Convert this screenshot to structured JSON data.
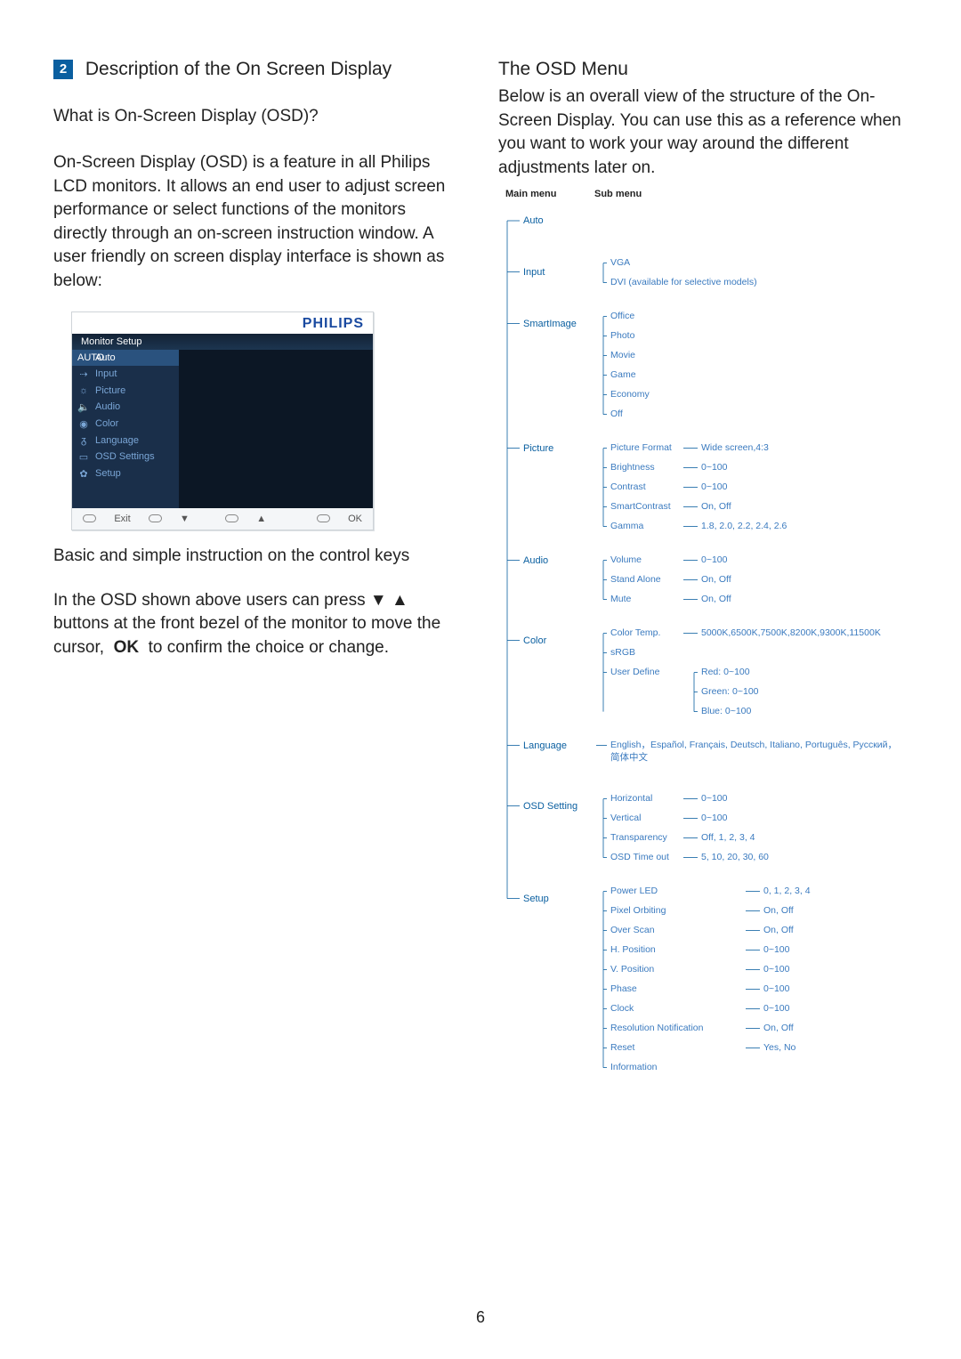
{
  "section_number": "2",
  "title": "Description of the On Screen Display",
  "q": "What is On-Screen Display (OSD)?",
  "body1": "On-Screen Display (OSD) is a feature in all Philips LCD monitors. It allows an end user to adjust screen performance or select functions of the monitors directly through an on-screen instruction window. A user friendly on screen display interface is shown as below:",
  "osd": {
    "brand": "PHILIPS",
    "header": "Monitor Setup",
    "items": [
      {
        "icon": "AUTO",
        "label": "Auto",
        "sel": true
      },
      {
        "icon": "⇢",
        "label": "Input"
      },
      {
        "icon": "☼",
        "label": "Picture"
      },
      {
        "icon": "🔈",
        "label": "Audio"
      },
      {
        "icon": "◉",
        "label": "Color"
      },
      {
        "icon": "ᵹ",
        "label": "Language"
      },
      {
        "icon": "▭",
        "label": "OSD Settings"
      },
      {
        "icon": "✿",
        "label": "Setup"
      }
    ],
    "foot": {
      "exit": "Exit",
      "ok": "OK"
    }
  },
  "basic_heading": "Basic and simple instruction on the control keys",
  "basic_body": "In the OSD shown above users can press ▼ ▲ buttons at the front bezel of the monitor to move the cursor,  OK  to confirm the choice or change.",
  "right_heading": "The OSD Menu",
  "right_body": "Below is an overall view of the structure of the On-Screen Display. You can use this as a reference when you want to work your way around the different adjustments later on.",
  "tree_header": {
    "main": "Main menu",
    "sub": "Sub menu"
  },
  "menu": {
    "auto": "Auto",
    "input": {
      "label": "Input",
      "items": [
        "VGA",
        "DVI (available for selective models)"
      ]
    },
    "smartimage": {
      "label": "SmartImage",
      "items": [
        "Office",
        "Photo",
        "Movie",
        "Game",
        "Economy",
        "Off"
      ]
    },
    "picture": {
      "label": "Picture",
      "items": [
        {
          "k": "Picture Format",
          "v": "Wide screen,4:3"
        },
        {
          "k": "Brightness",
          "v": "0~100"
        },
        {
          "k": "Contrast",
          "v": "0~100"
        },
        {
          "k": "SmartContrast",
          "v": "On, Off"
        },
        {
          "k": "Gamma",
          "v": "1.8, 2.0, 2.2, 2.4, 2.6"
        }
      ]
    },
    "audio": {
      "label": "Audio",
      "items": [
        {
          "k": "Volume",
          "v": "0~100"
        },
        {
          "k": "Stand Alone",
          "v": "On, Off"
        },
        {
          "k": "Mute",
          "v": "On, Off"
        }
      ]
    },
    "color": {
      "label": "Color",
      "items": [
        {
          "k": "Color Temp.",
          "v": "5000K,6500K,7500K,8200K,9300K,11500K"
        },
        {
          "k": "sRGB",
          "v": ""
        },
        {
          "k": "User Define",
          "sub": [
            "Red: 0~100",
            "Green: 0~100",
            "Blue: 0~100"
          ]
        }
      ]
    },
    "language": {
      "label": "Language",
      "v": "English，Español, Français, Deutsch, Italiano, Português, Русский，简体中文"
    },
    "osdsetting": {
      "label": "OSD Setting",
      "items": [
        {
          "k": "Horizontal",
          "v": "0~100"
        },
        {
          "k": "Vertical",
          "v": "0~100"
        },
        {
          "k": "Transparency",
          "v": "Off, 1, 2, 3, 4"
        },
        {
          "k": "OSD Time out",
          "v": "5, 10, 20, 30, 60"
        }
      ]
    },
    "setup": {
      "label": "Setup",
      "items": [
        {
          "k": "Power LED",
          "v": "0, 1, 2, 3, 4"
        },
        {
          "k": "Pixel Orbiting",
          "v": "On, Off"
        },
        {
          "k": "Over Scan",
          "v": "On, Off"
        },
        {
          "k": "H. Position",
          "v": "0~100"
        },
        {
          "k": "V. Position",
          "v": "0~100"
        },
        {
          "k": "Phase",
          "v": "0~100"
        },
        {
          "k": "Clock",
          "v": "0~100"
        },
        {
          "k": "Resolution Notification",
          "v": "On, Off"
        },
        {
          "k": "Reset",
          "v": "Yes, No"
        },
        {
          "k": "Information",
          "v": ""
        }
      ]
    }
  },
  "page_number": "6"
}
